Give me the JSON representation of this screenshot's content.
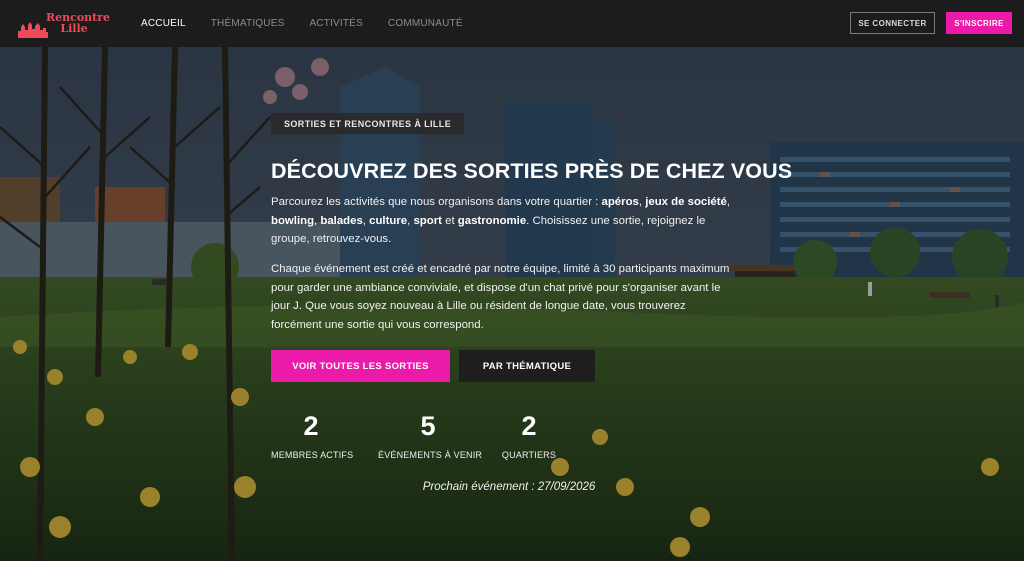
{
  "brand": {
    "name_line1": "Rencontre",
    "name_line2": "Lille",
    "logo_icon": "city-skyline-icon",
    "color": "#ef4a5a"
  },
  "nav": {
    "items": [
      {
        "label": "ACCUEIL",
        "active": true
      },
      {
        "label": "THÉMATIQUES",
        "active": false
      },
      {
        "label": "ACTIVITÉS",
        "active": false
      },
      {
        "label": "COMMUNAUTÉ",
        "active": false
      }
    ],
    "login_label": "SE CONNECTER",
    "signup_label": "S'INSCRIRE"
  },
  "hero": {
    "kicker": "SORTIES ET RENCONTRES À LILLE",
    "title": "DÉCOUVREZ DES SORTIES PRÈS DE CHEZ VOUS",
    "intro": {
      "before": "Parcourez les activités que nous organisons dans votre quartier : ",
      "highlights": [
        "apéros",
        "jeux de société",
        "bowling",
        "balades",
        "culture",
        "sport",
        "gastronomie"
      ],
      "after": "Choisissez une sortie, rejoignez le groupe, retrouvez-vous."
    },
    "description": "Chaque événement est créé et encadré par notre équipe, limité à 30 participants maximum pour garder une ambiance conviviale, et dispose d'un chat privé pour s'organiser avant le jour J. Que vous soyez nouveau à Lille ou résident de longue date, vous trouverez forcément une sortie qui vous correspond.",
    "primary_button": "VOIR TOUTES LES SORTIES",
    "secondary_button": "PAR THÉMATIQUE",
    "stats": [
      {
        "value": "2",
        "label": "MEMBRES ACTIFS"
      },
      {
        "value": "5",
        "label": "ÉVÉNEMENTS À VENIR"
      },
      {
        "value": "2",
        "label": "QUARTIERS"
      }
    ],
    "next_event": "Prochain événement : 27/09/2026"
  },
  "colors": {
    "accent": "#ec1aa8",
    "navbar": "#1c1c1c",
    "button_dark": "#1e1e1e"
  }
}
